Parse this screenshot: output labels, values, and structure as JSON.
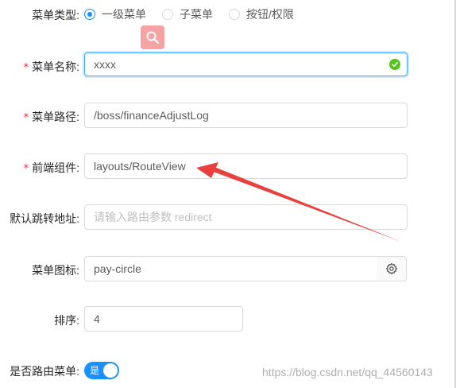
{
  "menu_type": {
    "label": "菜单类型:",
    "options": [
      "一级菜单",
      "子菜单",
      "按钮/权限"
    ],
    "selected": "一级菜单"
  },
  "menu_name": {
    "label": "菜单名称:",
    "value": "xxxx",
    "required": "*"
  },
  "menu_path": {
    "label": "菜单路径:",
    "value": "/boss/financeAdjustLog",
    "required": "*"
  },
  "component": {
    "label": "前端组件:",
    "value": "layouts/RouteView",
    "required": "*"
  },
  "redirect": {
    "label": "默认跳转地址:",
    "placeholder": "请输入路由参数 redirect"
  },
  "menu_icon": {
    "label": "菜单图标:",
    "value": "pay-circle",
    "icon": "gear-icon"
  },
  "sort": {
    "label": "排序:",
    "value": "4"
  },
  "route_menu": {
    "label": "是否路由菜单:",
    "switch_text": "是",
    "on": true
  },
  "watermark": "https://blog.csdn.net/qq_44560143",
  "colors": {
    "primary": "#1890ff",
    "success": "#52c41a",
    "required": "#f5222d",
    "arrow": "#e8403c"
  }
}
